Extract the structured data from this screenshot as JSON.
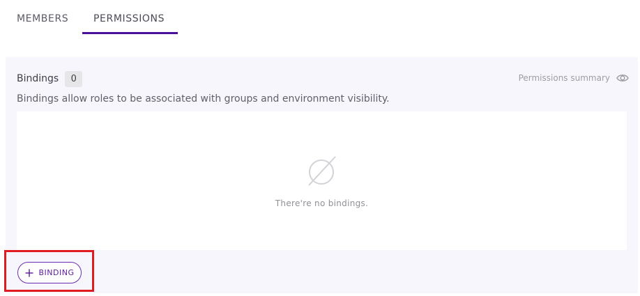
{
  "tabs": [
    {
      "label": "MEMBERS",
      "active": false
    },
    {
      "label": "PERMISSIONS",
      "active": true
    }
  ],
  "bindings": {
    "label": "Bindings",
    "count": "0",
    "summary_link": "Permissions summary",
    "description": "Bindings allow roles to be associated with groups and environment visibility.",
    "empty_text": "There're no bindings.",
    "add_button": "BINDING"
  },
  "icons": {
    "summary": "eye-icon",
    "empty_state": "empty-set-icon",
    "add": "plus-icon"
  },
  "colors": {
    "accent": "#4b0f9a",
    "button_border": "#6a2ab0",
    "panel_bg": "#f8f6fd",
    "highlight": "#e11b22"
  }
}
